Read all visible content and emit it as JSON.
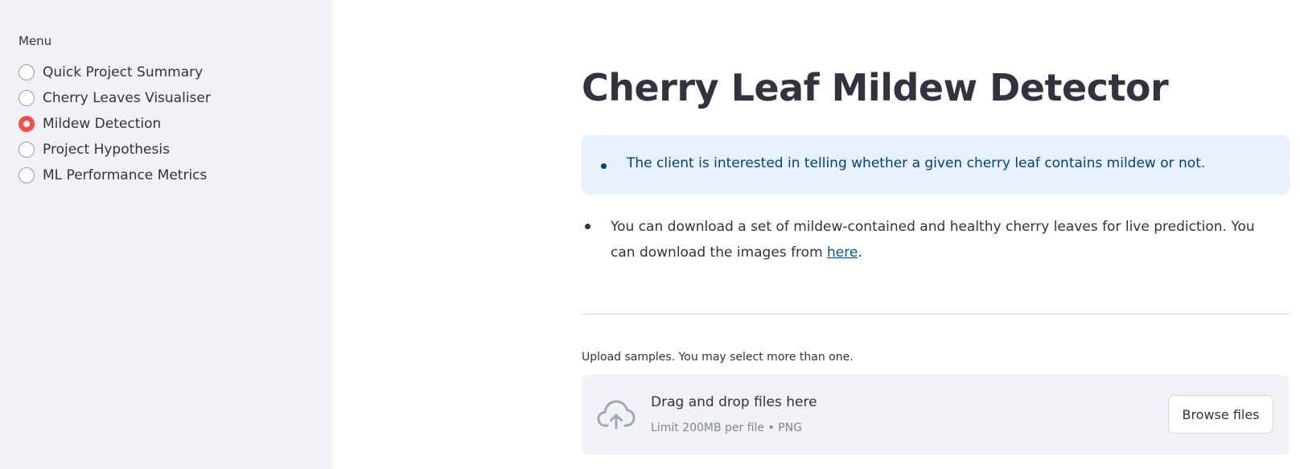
{
  "sidebar": {
    "menu_label": "Menu",
    "items": [
      {
        "label": "Quick Project Summary",
        "selected": false
      },
      {
        "label": "Cherry Leaves Visualiser",
        "selected": false
      },
      {
        "label": "Mildew Detection",
        "selected": true
      },
      {
        "label": "Project Hypothesis",
        "selected": false
      },
      {
        "label": "ML Performance Metrics",
        "selected": false
      }
    ]
  },
  "main": {
    "title": "Cherry Leaf Mildew Detector",
    "info": "The client is interested in telling whether a given cherry leaf contains mildew or not.",
    "body": {
      "text_before": "You can download a set of mildew-contained and healthy cherry leaves for live prediction. You can download the images from ",
      "link_text": "here",
      "text_after": "."
    },
    "uploader": {
      "label": "Upload samples. You may select more than one.",
      "drop_title": "Drag and drop files here",
      "drop_limit": "Limit 200MB per file • PNG",
      "browse_label": "Browse files",
      "icon": "cloud-upload-icon"
    }
  },
  "colors": {
    "accent": "#ff4b4b",
    "sidebar_bg": "#f0f2f6",
    "info_bg": "#e6f1fc",
    "info_text": "#004280",
    "link": "#0054a3"
  }
}
